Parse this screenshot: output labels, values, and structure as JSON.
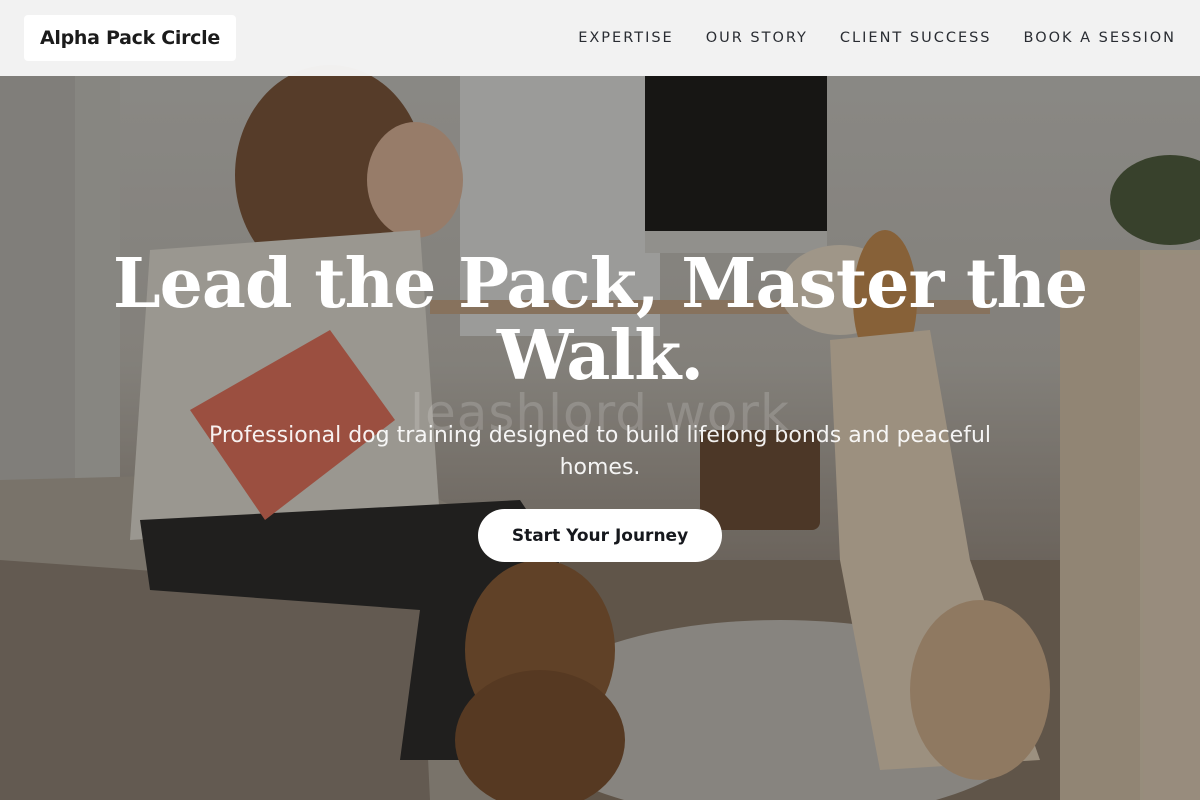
{
  "header": {
    "brand": "Alpha Pack Circle",
    "nav": [
      {
        "label": "EXPERTISE"
      },
      {
        "label": "OUR STORY"
      },
      {
        "label": "CLIENT SUCCESS"
      },
      {
        "label": "BOOK A SESSION"
      }
    ]
  },
  "hero": {
    "headline": "Lead the Pack, Master the Walk.",
    "subtitle": "Professional dog training designed to build lifelong bonds and peaceful homes.",
    "cta_label": "Start Your Journey",
    "watermark": "leashlord work",
    "image_alt": "Woman on a bed holding a bag of dog treats while two dogs sit in front of her"
  },
  "colors": {
    "header_bg": "#f6f6f6",
    "text_dark": "#1b1b1b",
    "headline": "#ffffff",
    "cta_bg": "#ffffff"
  }
}
